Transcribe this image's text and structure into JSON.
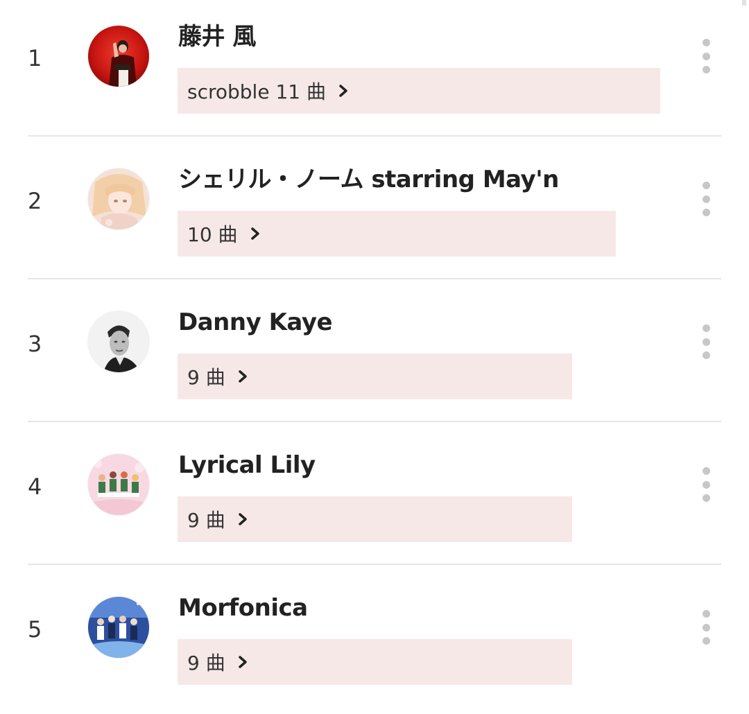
{
  "colors": {
    "bar_background": "#f7e8e8",
    "divider": "#e6e6e6",
    "kebab_dot": "#c7c7c7",
    "text": "#222222"
  },
  "artists": [
    {
      "rank": "1",
      "name": "藤井 風",
      "count_label": "scrobble 11 曲",
      "bar_fill_fraction": 0.644,
      "avatar_icon": "artist-avatar-red"
    },
    {
      "rank": "2",
      "name": "シェリル・ノーム starring May'n",
      "count_label": "10 曲",
      "bar_fill_fraction": 0.585,
      "avatar_icon": "artist-avatar-anime-blonde"
    },
    {
      "rank": "3",
      "name": "Danny Kaye",
      "count_label": "9 曲",
      "bar_fill_fraction": 0.527,
      "avatar_icon": "artist-avatar-bw-portrait"
    },
    {
      "rank": "4",
      "name": "Lyrical Lily",
      "count_label": "9 曲",
      "bar_fill_fraction": 0.527,
      "avatar_icon": "artist-avatar-group-pink"
    },
    {
      "rank": "5",
      "name": "Morfonica",
      "count_label": "9 曲",
      "bar_fill_fraction": 0.527,
      "avatar_icon": "artist-avatar-group-blue"
    }
  ]
}
